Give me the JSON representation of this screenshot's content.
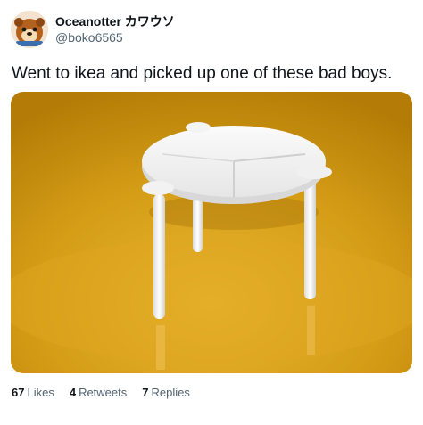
{
  "user": {
    "display_name": "Oceanotter カワウソ",
    "handle": "@boko6565"
  },
  "tweet": {
    "text": "Went to ikea and picked up one of these bad boys."
  },
  "stats": [
    {
      "count": "67",
      "label": "Likes"
    },
    {
      "count": "4",
      "label": "Retweets"
    },
    {
      "count": "7",
      "label": "Replies"
    }
  ],
  "colors": {
    "background": "#ffffff",
    "text": "#0f1419",
    "secondary_text": "#536471",
    "photo_backdrop": "#d9a21a"
  },
  "icons": [
    "avatar-otter-icon"
  ]
}
